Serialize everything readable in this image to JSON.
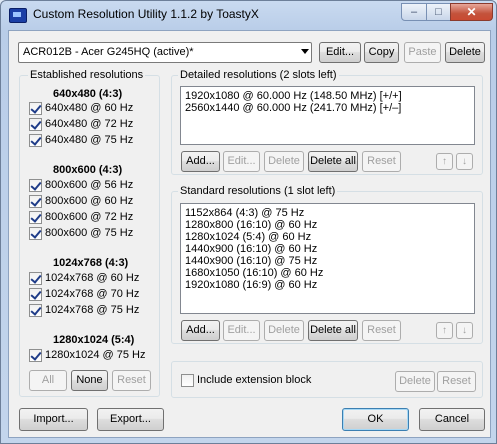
{
  "window": {
    "title": "Custom Resolution Utility 1.1.2 by ToastyX",
    "min_glyph": "–",
    "max_glyph": "□",
    "close_glyph": "✕"
  },
  "toolbar": {
    "monitor": "ACR012B - Acer G245HQ (active)*",
    "edit": "Edit...",
    "copy": "Copy",
    "paste": "Paste",
    "delete": "Delete"
  },
  "established": {
    "title": "Established resolutions",
    "groups": [
      {
        "heading": "640x480 (4:3)",
        "items": [
          "640x480 @ 60 Hz",
          "640x480 @ 72 Hz",
          "640x480 @ 75 Hz"
        ]
      },
      {
        "heading": "800x600 (4:3)",
        "items": [
          "800x600 @ 56 Hz",
          "800x600 @ 60 Hz",
          "800x600 @ 72 Hz",
          "800x600 @ 75 Hz"
        ]
      },
      {
        "heading": "1024x768 (4:3)",
        "items": [
          "1024x768 @ 60 Hz",
          "1024x768 @ 70 Hz",
          "1024x768 @ 75 Hz"
        ]
      },
      {
        "heading": "1280x1024 (5:4)",
        "items": [
          "1280x1024 @ 75 Hz"
        ]
      }
    ],
    "all": "All",
    "none": "None",
    "reset": "Reset"
  },
  "detailed": {
    "title": "Detailed resolutions (2 slots left)",
    "items": [
      "1920x1080 @ 60.000 Hz (148.50 MHz) [+/+]",
      "2560x1440 @ 60.000 Hz (241.70 MHz) [+/–]"
    ],
    "add": "Add...",
    "edit": "Edit...",
    "delete": "Delete",
    "delete_all": "Delete all",
    "reset": "Reset",
    "up": "↑",
    "down": "↓"
  },
  "standard": {
    "title": "Standard resolutions (1 slot left)",
    "items": [
      "1152x864 (4:3) @ 75 Hz",
      "1280x800 (16:10) @ 60 Hz",
      "1280x1024 (5:4) @ 60 Hz",
      "1440x900 (16:10) @ 60 Hz",
      "1440x900 (16:10) @ 75 Hz",
      "1680x1050 (16:10) @ 60 Hz",
      "1920x1080 (16:9) @ 60 Hz"
    ],
    "add": "Add...",
    "edit": "Edit...",
    "delete": "Delete",
    "delete_all": "Delete all",
    "reset": "Reset",
    "up": "↑",
    "down": "↓"
  },
  "extension": {
    "checkbox_label": "Include extension block",
    "delete": "Delete",
    "reset": "Reset"
  },
  "footer": {
    "import": "Import...",
    "export": "Export...",
    "ok": "OK",
    "cancel": "Cancel"
  }
}
